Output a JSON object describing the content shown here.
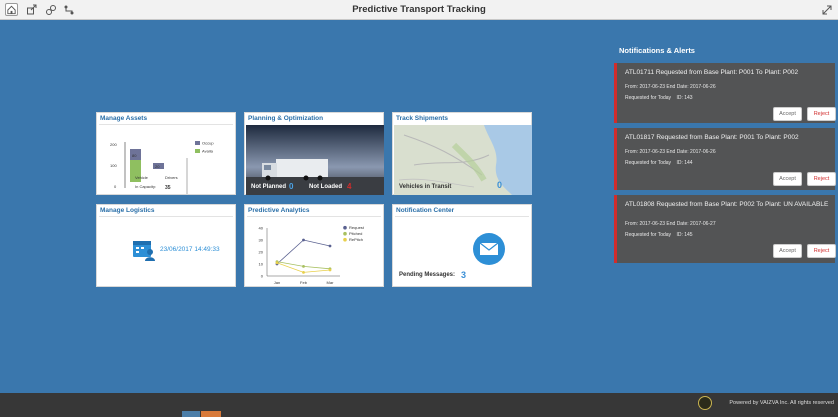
{
  "header": {
    "title": "Predictive Transport Tracking",
    "icons": [
      "home-icon",
      "share-icon",
      "link-icon",
      "route-icon"
    ],
    "right_icon": "expand-icon"
  },
  "tiles": {
    "manage_assets": {
      "title": "Manage Assets",
      "yticks": [
        "200",
        "100",
        "0"
      ],
      "legend": [
        "Occup",
        "Availa"
      ],
      "bar_labels": [
        "Vehicle",
        "Drivers"
      ],
      "bar_values": [
        "80",
        "20"
      ],
      "footer_label": "In Capacity:",
      "footer_value": "35"
    },
    "planning": {
      "title": "Planning & Optimization",
      "not_planned_label": "Not Planned",
      "not_planned_value": "0",
      "not_loaded_label": "Not Loaded",
      "not_loaded_value": "4"
    },
    "track": {
      "title": "Track Shipments",
      "vehicles_label": "Vehicles in Transit",
      "vehicles_value": "0"
    },
    "logistics": {
      "title": "Manage Logistics",
      "datetime": "23/06/2017 14:49:33"
    },
    "predictive": {
      "title": "Predictive Analytics",
      "legend": [
        "Request",
        "Pitched",
        "RePitch"
      ]
    },
    "notification_center": {
      "title": "Notification Center",
      "pending_label": "Pending Messages:",
      "pending_value": "3"
    }
  },
  "chart_data": {
    "type": "line",
    "categories": [
      "Jan",
      "Feb",
      "Mar"
    ],
    "ylim": [
      0,
      40
    ],
    "yticks": [
      0,
      10,
      20,
      30,
      40
    ],
    "series": [
      {
        "name": "Request",
        "values": [
          10,
          30,
          25
        ],
        "color": "#5a6190"
      },
      {
        "name": "Pitched",
        "values": [
          12,
          8,
          6
        ],
        "color": "#a8c060"
      },
      {
        "name": "RePitch",
        "values": [
          11,
          3,
          5
        ],
        "color": "#e8d04c"
      }
    ]
  },
  "notifications_header": "Notifications & Alerts",
  "notifications": [
    {
      "title": "ATL01711 Requested from Base Plant: P001 To Plant: P002",
      "dates": "From: 2017-06-23 End Date: 2017-06-26",
      "requested": "Requested for Today",
      "id": "ID: 143",
      "accept": "Accept",
      "reject": "Reject"
    },
    {
      "title": "ATL01817 Requested from Base Plant: P001 To Plant: P002",
      "dates": "From: 2017-06-23 End Date: 2017-06-26",
      "requested": "Requested for Today",
      "id": "ID: 144",
      "accept": "Accept",
      "reject": "Reject"
    },
    {
      "title": "ATL01808 Requested from Base Plant: P002 To Plant: UN AVAILABLE",
      "dates": "From: 2017-06-23 End Date: 2017-06-27",
      "requested": "Requested for Today",
      "id": "ID: 145",
      "accept": "Accept",
      "reject": "Reject"
    }
  ],
  "footer": {
    "text": "Powered by VAIZVA Inc. All rights reserved"
  },
  "colors": {
    "background": "#3a77ad",
    "tile_title": "#2a6fa8",
    "reject_accent": "#d12c2c",
    "notification_bg": "#535455"
  }
}
